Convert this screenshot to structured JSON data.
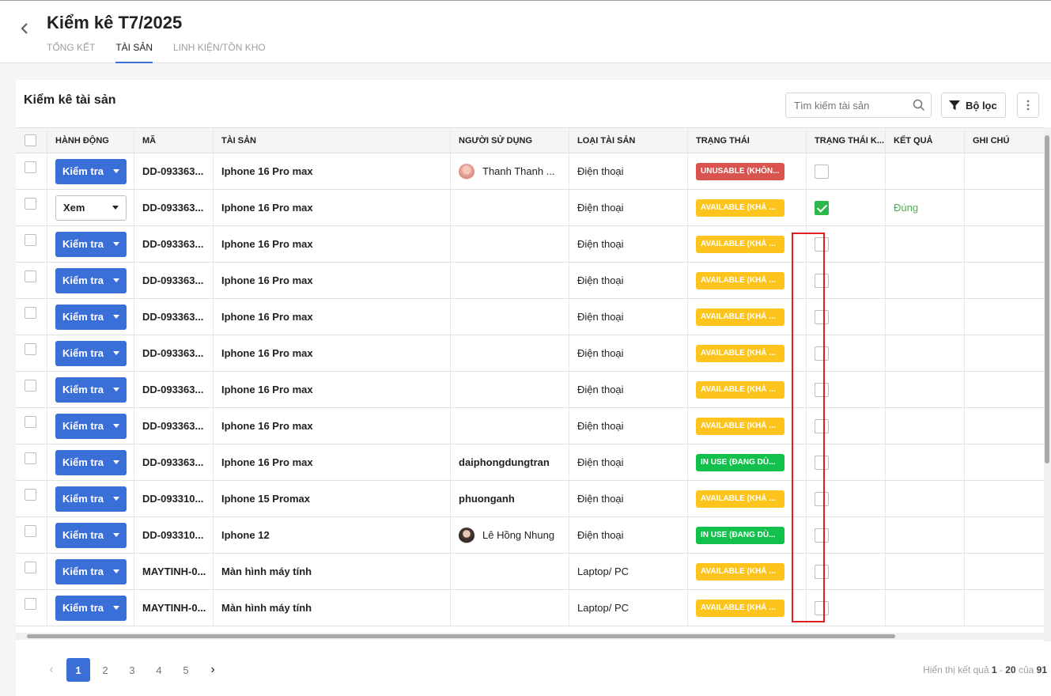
{
  "header": {
    "title": "Kiểm kê T7/2025",
    "tabs": [
      "TỔNG KẾT",
      "TÀI SẢN",
      "LINH KIỆN/TỒN KHO"
    ]
  },
  "card": {
    "title": "Kiểm kê tài sản",
    "search_placeholder": "Tìm kiếm tài sản",
    "filter_label": "Bộ lọc"
  },
  "table": {
    "columns": [
      "HÀNH ĐỘNG",
      "MÃ",
      "TÀI SẢN",
      "NGƯỜI SỬ DỤNG",
      "LOẠI TÀI SẢN",
      "TRẠNG THÁI",
      "TRẠNG THÁI K...",
      "KẾT QUẢ",
      "GHI CHÚ"
    ],
    "rows": [
      {
        "action": "Kiểm tra",
        "code": "DD-093363...",
        "asset": "Iphone 16 Pro max",
        "user": "Thanh Thanh ...",
        "type": "Điện thoại",
        "status": "UNUSABLE (KHÔN...",
        "checked": false,
        "result": ""
      },
      {
        "action": "Xem",
        "code": "DD-093363...",
        "asset": "Iphone 16 Pro max",
        "user": "",
        "type": "Điện thoại",
        "status": "AVAILABLE (KHẢ ...",
        "checked": true,
        "result": "Đúng"
      },
      {
        "action": "Kiểm tra",
        "code": "DD-093363...",
        "asset": "Iphone 16 Pro max",
        "user": "",
        "type": "Điện thoại",
        "status": "AVAILABLE (KHẢ ...",
        "checked": false,
        "result": ""
      },
      {
        "action": "Kiểm tra",
        "code": "DD-093363...",
        "asset": "Iphone 16 Pro max",
        "user": "",
        "type": "Điện thoại",
        "status": "AVAILABLE (KHẢ ...",
        "checked": false,
        "result": ""
      },
      {
        "action": "Kiểm tra",
        "code": "DD-093363...",
        "asset": "Iphone 16 Pro max",
        "user": "",
        "type": "Điện thoại",
        "status": "AVAILABLE (KHẢ ...",
        "checked": false,
        "result": ""
      },
      {
        "action": "Kiểm tra",
        "code": "DD-093363...",
        "asset": "Iphone 16 Pro max",
        "user": "",
        "type": "Điện thoại",
        "status": "AVAILABLE (KHẢ ...",
        "checked": false,
        "result": ""
      },
      {
        "action": "Kiểm tra",
        "code": "DD-093363...",
        "asset": "Iphone 16 Pro max",
        "user": "",
        "type": "Điện thoại",
        "status": "AVAILABLE (KHẢ ...",
        "checked": false,
        "result": ""
      },
      {
        "action": "Kiểm tra",
        "code": "DD-093363...",
        "asset": "Iphone 16 Pro max",
        "user": "",
        "type": "Điện thoại",
        "status": "AVAILABLE (KHẢ ...",
        "checked": false,
        "result": ""
      },
      {
        "action": "Kiểm tra",
        "code": "DD-093363...",
        "asset": "Iphone 16 Pro max",
        "user": "daiphongdungtran",
        "type": "Điện thoại",
        "status": "IN USE (ĐANG DÙ...",
        "checked": false,
        "result": ""
      },
      {
        "action": "Kiểm tra",
        "code": "DD-093310...",
        "asset": "Iphone 15 Promax",
        "user": "phuonganh",
        "type": "Điện thoại",
        "status": "AVAILABLE (KHẢ ...",
        "checked": false,
        "result": ""
      },
      {
        "action": "Kiểm tra",
        "code": "DD-093310...",
        "asset": "Iphone 12",
        "user": "Lê Hồng Nhung",
        "type": "Điện thoại",
        "status": "IN USE (ĐANG DÙ...",
        "checked": false,
        "result": ""
      },
      {
        "action": "Kiểm tra",
        "code": "MAYTINH-0...",
        "asset": "Màn hình máy tính",
        "user": "",
        "type": "Laptop/ PC",
        "status": "AVAILABLE (KHẢ ...",
        "checked": false,
        "result": ""
      },
      {
        "action": "Kiểm tra",
        "code": "MAYTINH-0...",
        "asset": "Màn hình máy tính",
        "user": "",
        "type": "Laptop/ PC",
        "status": "AVAILABLE (KHẢ ...",
        "checked": false,
        "result": ""
      }
    ]
  },
  "pagination": {
    "pages": [
      "1",
      "2",
      "3",
      "4",
      "5"
    ],
    "current": "1",
    "result_prefix": "Hiển thị kết quả",
    "range_start": "1",
    "range_sep": "-",
    "range_end": "20",
    "of_label": "của",
    "total": "91"
  },
  "colors": {
    "primary": "#3b6fd8",
    "unusable": "#d9534f",
    "available": "#fcc41c",
    "inuse": "#11c14c",
    "highlight": "#e02020"
  }
}
